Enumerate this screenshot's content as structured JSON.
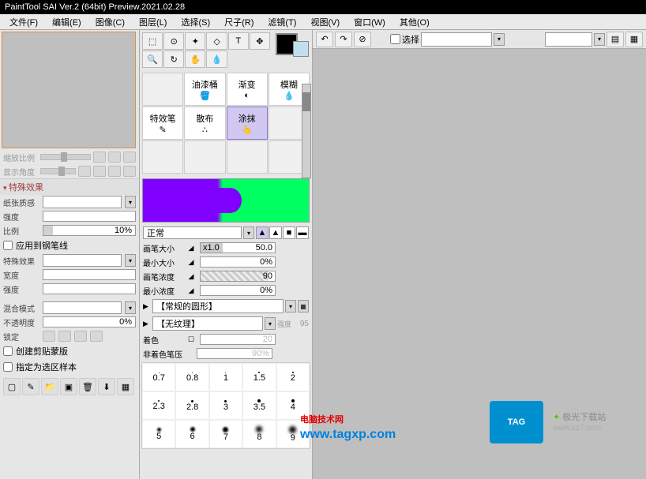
{
  "title": "PaintTool SAI Ver.2 (64bit) Preview.2021.02.28",
  "menu": [
    "文件(F)",
    "编辑(E)",
    "图像(C)",
    "图层(L)",
    "选择(S)",
    "尺子(R)",
    "滤镜(T)",
    "视图(V)",
    "窗口(W)",
    "其他(O)"
  ],
  "left": {
    "zoom_label": "缩放比例",
    "angle_label": "显示角度",
    "effects_header": "特殊效果",
    "paper_label": "纸张质感",
    "strength_label": "强度",
    "ratio_label": "比例",
    "ratio_val": "10%",
    "apply_pen": "应用到钢笔线",
    "effect_label": "特殊效果",
    "width_label": "宽度",
    "strength2_label": "强度",
    "blend_label": "混合模式",
    "opacity_label": "不透明度",
    "opacity_val": "0%",
    "lock_label": "锁定",
    "clip_mask": "创建剪贴蒙版",
    "sample_lock": "指定为选区样本"
  },
  "brushes": {
    "r1": [
      "",
      "油漆桶",
      "渐变",
      "模糊"
    ],
    "r2": [
      "特效笔",
      "散布",
      "涂抹",
      ""
    ]
  },
  "mid": {
    "blend_mode": "正常",
    "brush_size_label": "画笔大小",
    "brush_size_mult": "x1.0",
    "brush_size_val": "50.0",
    "min_size_label": "最小大小",
    "min_size_val": "0%",
    "density_label": "画笔浓度",
    "density_val": "90",
    "min_density_label": "最小浓度",
    "min_density_val": "0%",
    "preset1": "【常规的圆形】",
    "preset2": "【无纹理】",
    "preset2_val": "95",
    "preset2_strength": "强度",
    "tint_label": "着色",
    "tint_val": "20",
    "notint_label": "非着色笔压",
    "notint_val": "90%"
  },
  "sizes_r1": [
    "0.7",
    "0.8",
    "1",
    "1.5",
    "2"
  ],
  "sizes_r2": [
    "2.3",
    "2.8",
    "3",
    "3.5",
    "4"
  ],
  "sizes_r3": [
    "5",
    "6",
    "7",
    "8",
    "9"
  ],
  "toolbar": {
    "select_label": "选择"
  },
  "wm": {
    "text1": "电脑技术网",
    "url1": "www.tagxp.com",
    "tag": "TAG",
    "text2": "极光下载站",
    "url2": "www.xz7.com"
  }
}
